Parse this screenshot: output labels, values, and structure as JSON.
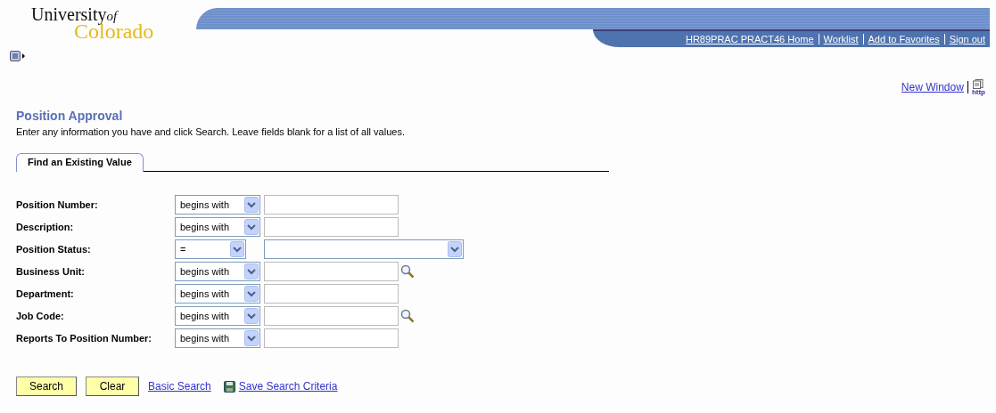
{
  "logo": {
    "line1": "University",
    "of": "of",
    "line2": "Colorado"
  },
  "nav_links": [
    "HR89PRAC PRACT46 Home",
    "Worklist",
    "Add to Favorites",
    "Sign out"
  ],
  "new_window": {
    "label": "New Window",
    "icon_text": "http"
  },
  "page_title": "Position Approval",
  "instructions": "Enter any information you have and click Search. Leave fields blank for a list of all values.",
  "tabs": [
    {
      "label": "Find an Existing Value",
      "selected": true
    }
  ],
  "fields": [
    {
      "label": "Position Number:",
      "operator": "begins with",
      "kind": "text",
      "lookup": false
    },
    {
      "label": "Description:",
      "operator": "begins with",
      "kind": "text",
      "lookup": false
    },
    {
      "label": "Position Status:",
      "operator": "=",
      "kind": "select",
      "lookup": false
    },
    {
      "label": "Business Unit:",
      "operator": "begins with",
      "kind": "text",
      "lookup": true
    },
    {
      "label": "Department:",
      "operator": "begins with",
      "kind": "text",
      "lookup": false
    },
    {
      "label": "Job Code:",
      "operator": "begins with",
      "kind": "text",
      "lookup": true
    },
    {
      "label": "Reports To Position Number:",
      "operator": "begins with",
      "kind": "text",
      "lookup": false
    }
  ],
  "buttons": [
    "Search",
    "Clear"
  ],
  "links": [
    "Basic Search",
    "Save Search Criteria"
  ]
}
